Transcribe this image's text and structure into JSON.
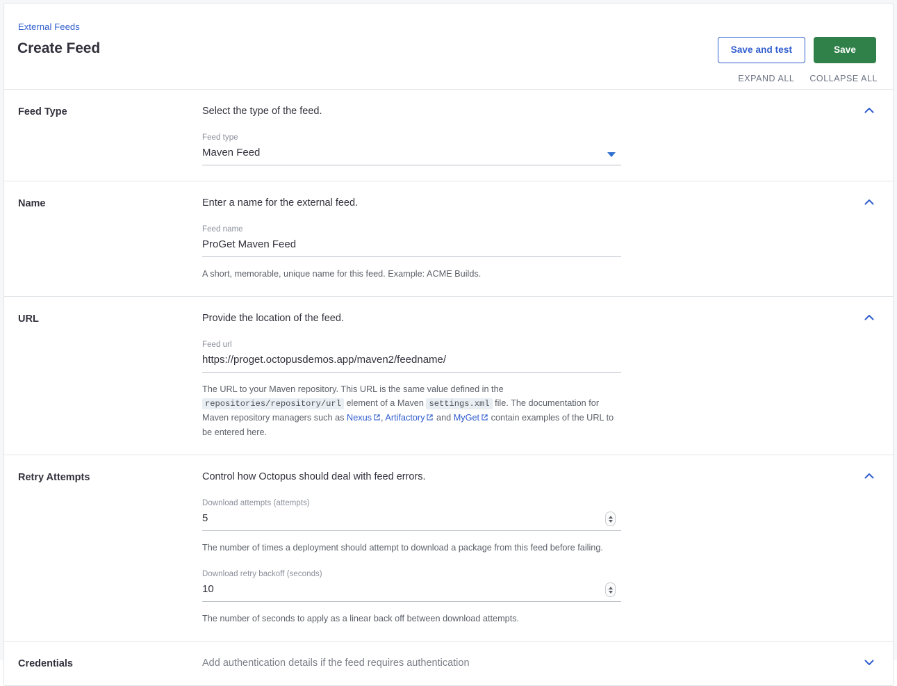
{
  "header": {
    "breadcrumb": "External Feeds",
    "title": "Create Feed",
    "save_and_test_label": "Save and test",
    "save_label": "Save",
    "expand_all_label": "EXPAND ALL",
    "collapse_all_label": "COLLAPSE ALL"
  },
  "colors": {
    "link": "#2f5cce",
    "primary_button": "#2f8049",
    "chevron": "#2f5cce",
    "caret": "#2f6fd0",
    "code_chip_bg": "#e9eef3"
  },
  "sections": {
    "feed_type": {
      "label": "Feed Type",
      "summary": "Select the type of the feed.",
      "chevron": "chevron-up-icon",
      "field": {
        "label": "Feed type",
        "value": "Maven Feed"
      }
    },
    "name": {
      "label": "Name",
      "summary": "Enter a name for the external feed.",
      "chevron": "chevron-up-icon",
      "field": {
        "label": "Feed name",
        "value": "ProGet Maven Feed",
        "help": "A short, memorable, unique name for this feed. Example: ACME Builds."
      }
    },
    "url": {
      "label": "URL",
      "summary": "Provide the location of the feed.",
      "chevron": "chevron-up-icon",
      "field": {
        "label": "Feed url",
        "value": "https://proget.octopusdemos.app/maven2/feedname/"
      },
      "help": {
        "part1": "The URL to your Maven repository. This URL is the same value defined in the",
        "code1": "repositories/repository/url",
        "part2": "element of a Maven",
        "code2": "settings.xml",
        "part3": "file. The documentation for Maven repository managers such as",
        "link1": "Nexus",
        "sep1": ",",
        "link2": "Artifactory",
        "sep2": "and",
        "link3": "MyGet",
        "part4": "contain examples of the URL to be entered here."
      }
    },
    "retry_attempts": {
      "label": "Retry Attempts",
      "summary": "Control how Octopus should deal with feed errors.",
      "chevron": "chevron-up-icon",
      "attempts": {
        "label": "Download attempts (attempts)",
        "value": "5",
        "help": "The number of times a deployment should attempt to download a package from this feed before failing."
      },
      "backoff": {
        "label": "Download retry backoff (seconds)",
        "value": "10",
        "help": "The number of seconds to apply as a linear back off between download attempts."
      }
    },
    "credentials": {
      "label": "Credentials",
      "summary": "Add authentication details if the feed requires authentication",
      "chevron": "chevron-down-icon"
    }
  }
}
